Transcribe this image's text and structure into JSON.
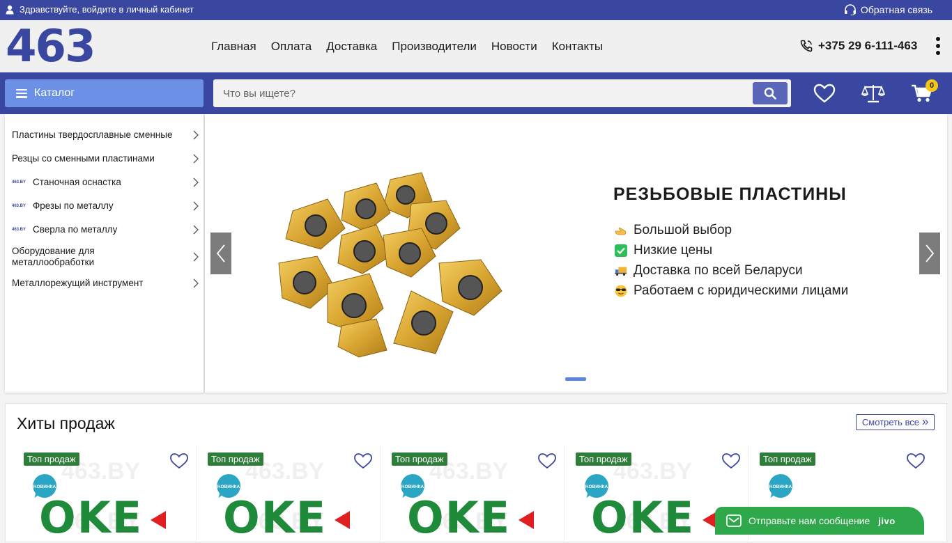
{
  "topbar": {
    "login_text": "Здравствуйте, войдите в личный кабинет",
    "feedback_text": "Обратная связь"
  },
  "header": {
    "logo": "463",
    "nav": [
      "Главная",
      "Оплата",
      "Доставка",
      "Производители",
      "Новости",
      "Контакты"
    ],
    "phone": "+375 29 6-111-463"
  },
  "toolbar": {
    "catalog_label": "Каталог",
    "search_placeholder": "Что вы ищете?",
    "cart_count": "0"
  },
  "sidebar": {
    "items": [
      {
        "label": "Пластины твердосплавные сменные",
        "mini": ""
      },
      {
        "label": "Резцы со сменными пластинами",
        "mini": ""
      },
      {
        "label": "Станочная оснастка",
        "mini": "463.BY"
      },
      {
        "label": "Фрезы по металлу",
        "mini": "463.BY"
      },
      {
        "label": "Сверла по металлу",
        "mini": "463.BY"
      },
      {
        "label": "Оборудование для металлообработки",
        "mini": ""
      },
      {
        "label": "Металлорежущий инструмент",
        "mini": ""
      }
    ]
  },
  "banner": {
    "title": "РЕЗЬБОВЫЕ ПЛАСТИНЫ",
    "features": [
      {
        "icon": "pointing-hand-icon",
        "text": "Большой выбор"
      },
      {
        "icon": "check-box-icon",
        "text": "Низкие цены"
      },
      {
        "icon": "truck-icon",
        "text": "Доставка по всей Беларуси"
      },
      {
        "icon": "cool-face-icon",
        "text": "Работаем с юридическими лицами"
      }
    ]
  },
  "hits": {
    "title": "Хиты продаж",
    "see_all": "Смотреть все",
    "cards": [
      {
        "tag": "Топ продаж",
        "badge": "НОВИНКА",
        "brand": "OKE",
        "watermark": "463.BY"
      },
      {
        "tag": "Топ продаж",
        "badge": "НОВИНКА",
        "brand": "OKE",
        "watermark": "463.BY"
      },
      {
        "tag": "Топ продаж",
        "badge": "НОВИНКА",
        "brand": "OKE",
        "watermark": "463.BY"
      },
      {
        "tag": "Топ продаж",
        "badge": "НОВИНКА",
        "brand": "OKE",
        "watermark": "463.BY"
      },
      {
        "tag": "Топ продаж",
        "badge": "НОВИНКА",
        "brand": "",
        "watermark": ""
      }
    ]
  },
  "chat": {
    "label": "Отправьте нам сообщение",
    "brand": "jivo"
  },
  "colors": {
    "brand_blue": "#3a47a0",
    "catalog_blue": "#6a91e6",
    "tag_green": "#2e7d3a",
    "chat_green": "#2ea84a",
    "badge_yellow": "#f5c518"
  }
}
